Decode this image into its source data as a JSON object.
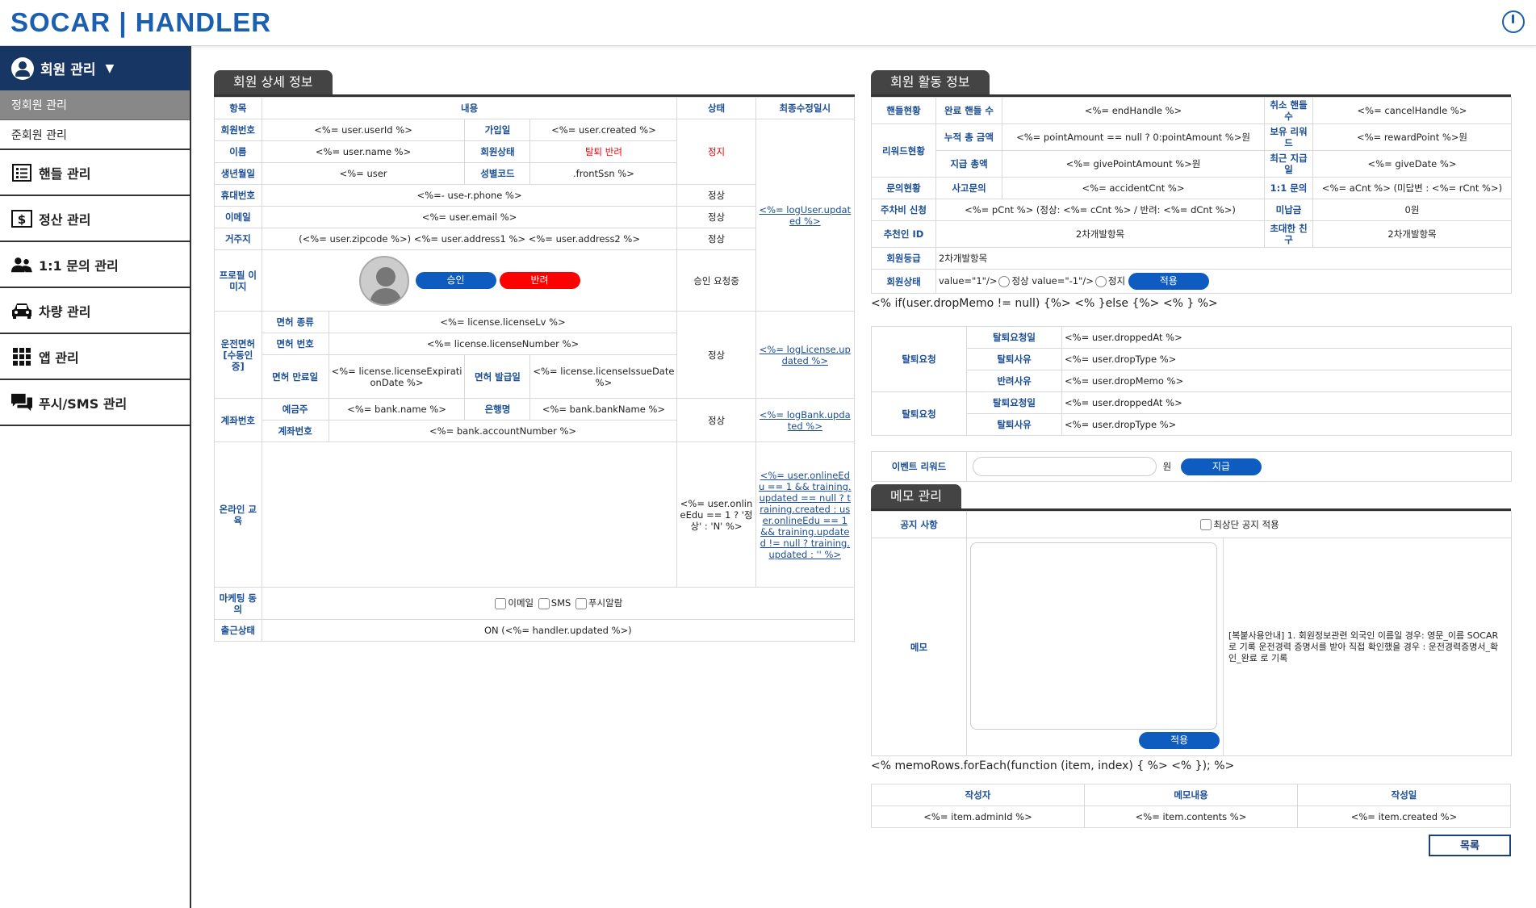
{
  "header": {
    "logo": "SOCAR | HANDLER"
  },
  "sidebar": {
    "member_mgmt": "회원 관리",
    "sub_items": [
      "정회원 관리",
      "준회원 관리"
    ],
    "items": [
      "핸들 관리",
      "정산 관리",
      "1:1 문의 관리",
      "차량 관리",
      "앱 관리",
      "푸시/SMS 관리"
    ]
  },
  "detail": {
    "title": "회원 상세 정보",
    "head": {
      "item": "항목",
      "content": "내용",
      "status": "상태",
      "updated": "최종수정일시"
    },
    "member_no": "회원번호",
    "member_no_val": "<%= user.userId %>",
    "join": "가입일",
    "join_val": "<%= user.created %>",
    "name": "이름",
    "name_val": "<%= user.name %>",
    "member_state": "회원상태",
    "member_state_val": "탈퇴 반려",
    "stop": "정지",
    "birth": "생년월일",
    "birth_val": "<%= user",
    "gender": "성별코드",
    "gender_val": ".frontSsn %>",
    "phone": "휴대번호",
    "phone_val": "<%=- use-r.phone %>",
    "normal": "정상",
    "email": "이메일",
    "email_val": "<%= user.email %>",
    "address": "거주지",
    "address_val": "(<%= user.zipcode %>) <%= user.address1 %> <%= user.address2 %>",
    "log_user": "<%= logUser.updated %>",
    "profile": "프로필 이미지",
    "approve": "승인",
    "reject": "반려",
    "approve_pending": "승인 요청중",
    "license": "운전면허 [수동인증]",
    "lic_type": "면허 종류",
    "lic_type_val": "<%= license.licenseLv %>",
    "lic_no": "면허 번호",
    "lic_no_val": "<%= license.licenseNumber %>",
    "lic_exp": "면허 만료일",
    "lic_exp_val": "<%= license.licenseExpirationDate %>",
    "lic_issue": "면허 발급일",
    "lic_issue_val": "<%= license.licenseIssueDate %>",
    "log_license": "<%= logLicense.updated %>",
    "account": "계좌번호",
    "holder": "예금주",
    "holder_val": "<%= bank.name %>",
    "bank": "은행명",
    "bank_val": "<%= bank.bankName %>",
    "acc_no": "계좌번호",
    "acc_no_val": "<%= bank.accountNumber %>",
    "log_bank": "<%= logBank.updated %>",
    "online": "온라인 교육",
    "online_state": "<%= user.onlineEdu == 1 ? '정상' : 'N' %>",
    "online_updated": "<%= user.onlineEdu == 1 && training.updated == null ? training.created : user.onlineEdu == 1 && training.updated != null ? training.updated : '' %>",
    "marketing": "마케팅 동의",
    "mk_email": "이메일",
    "mk_sms": "SMS",
    "mk_push": "푸시알람",
    "work": "출근상태",
    "work_val": "ON (<%= handler.updated %>)"
  },
  "activity": {
    "title": "회원 활동 정보",
    "handle_status": "핸들현황",
    "done_cnt": "완료 핸들 수",
    "done_val": "<%= endHandle %>",
    "cancel_cnt": "취소 핸들 수",
    "cancel_val": "<%= cancelHandle %>",
    "reward_status": "리워드현황",
    "accum": "누적 총 금액",
    "accum_val": "<%= pointAmount == null ? 0:pointAmount %>원",
    "hold": "보유 리워드",
    "hold_val": "<%= rewardPoint %>원",
    "pay_total": "지급 총액",
    "pay_total_val": "<%= givePointAmount %>원",
    "recent_pay": "최근 지급일",
    "recent_pay_val": "<%= giveDate %>",
    "inquiry_status": "문의현황",
    "accident": "사고문의",
    "accident_val": "<%= accidentCnt %>",
    "one": "1:1 문의",
    "one_val": "<%= aCnt %> (미답변 : <%= rCnt %>)",
    "parking": "주차비 신청",
    "parking_val": "<%= pCnt %> (정상: <%= cCnt %> / 반려: <%= dCnt %>)",
    "unpaid": "미납금",
    "unpaid_val": "0원",
    "referrer": "추천인 ID",
    "referrer_val": "2차개발항목",
    "invited": "초대한 친구",
    "invited_val": "2차개발항목",
    "grade": "회원등급",
    "grade_val": "2차개발항목",
    "state": "회원상태",
    "state_val1": "value=\"1\"/>",
    "normal": "정상",
    "state_val2": "value=\"-1\"/>",
    "stop": "정지",
    "apply": "적용",
    "tmpl_if": "<% if(user.dropMemo != null) {%> <% }else {%> <% } %>",
    "withdraw": "탈퇴요청",
    "w_date": "탈퇴요청일",
    "w_date_val": "<%= user.droppedAt %>",
    "w_reason": "탈퇴사유",
    "w_reason_val": "<%= user.dropType %>",
    "reject_reason": "반려사유",
    "reject_val": "<%= user.dropMemo %>",
    "event_reward": "이벤트 리워드",
    "won": "원",
    "give": "지급"
  },
  "memo": {
    "title": "메모 관리",
    "notice": "공지 사항",
    "top_notice": "최상단 공지 적용",
    "memo": "메모",
    "apply": "적용",
    "guide": "[복붙사용안내] 1. 회원정보관련 외국인 이름일 경우: 영문_이름 SOCAR로 기록 운전경력 증명서를 받아 직접 확인했을 경우 : 운전경력증명서_확인_완료 로 기록",
    "tmpl_each": "<% memoRows.forEach(function (item, index) { %> <% }); %>",
    "col_writer": "작성자",
    "col_content": "메모내용",
    "col_date": "작성일",
    "writer_val": "<%= item.adminId %>",
    "content_val": "<%= item.contents %>",
    "date_val": "<%= item.created %>",
    "list": "목록"
  },
  "colors": {
    "brand": "#1b5fb0",
    "nav": "#183663",
    "button": "#0f5cc0",
    "danger": "#ff0000"
  }
}
